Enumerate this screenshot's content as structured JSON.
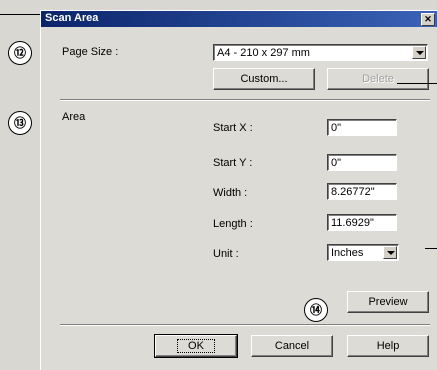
{
  "dialog": {
    "title": "Scan Area",
    "close_glyph": "✕",
    "page_size": {
      "label": "Page Size :",
      "value": "A4 - 210 x 297 mm"
    },
    "buttons": {
      "custom": "Custom...",
      "delete": "Delete",
      "preview": "Preview",
      "ok": "OK",
      "cancel": "Cancel",
      "help": "Help"
    },
    "area": {
      "label": "Area",
      "start_x_label": "Start X :",
      "start_x_value": "0\"",
      "start_y_label": "Start Y :",
      "start_y_value": "0\"",
      "width_label": "Width :",
      "width_value": "8.26772\"",
      "length_label": "Length :",
      "length_value": "11.6929\"",
      "unit_label": "Unit :",
      "unit_value": "Inches"
    }
  },
  "callouts": {
    "c12": "⑫",
    "c13": "⑬",
    "c14": "⑭"
  }
}
